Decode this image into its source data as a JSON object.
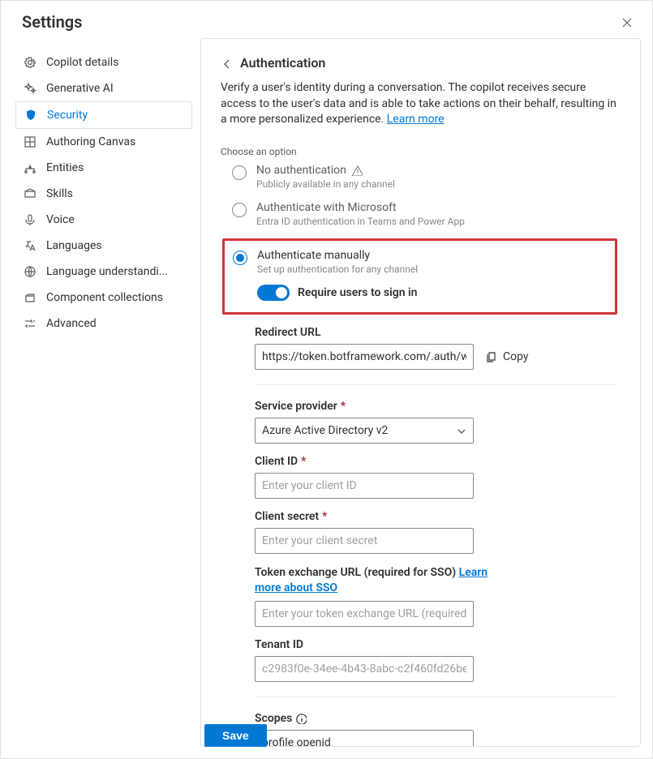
{
  "header": {
    "title": "Settings"
  },
  "sidebar": {
    "items": [
      {
        "label": "Copilot details"
      },
      {
        "label": "Generative AI"
      },
      {
        "label": "Security",
        "selected": true
      },
      {
        "label": "Authoring Canvas"
      },
      {
        "label": "Entities"
      },
      {
        "label": "Skills"
      },
      {
        "label": "Voice"
      },
      {
        "label": "Languages"
      },
      {
        "label": "Language understandi..."
      },
      {
        "label": "Component collections"
      },
      {
        "label": "Advanced"
      }
    ]
  },
  "page": {
    "title": "Authentication",
    "description_prefix": "Verify a user's identity during a conversation. The copilot receives secure access to the user's data and is able to take actions on their behalf, resulting in a more personalized experience. ",
    "learn_more": "Learn more",
    "choose_label": "Choose an option",
    "options": {
      "none": {
        "title": "No authentication",
        "sub": "Publicly available in any channel"
      },
      "ms": {
        "title": "Authenticate with Microsoft",
        "sub": "Entra ID authentication in Teams and Power App"
      },
      "manual": {
        "title": "Authenticate manually",
        "sub": "Set up authentication for any channel"
      }
    },
    "toggle_label": "Require users to sign in",
    "redirect": {
      "label": "Redirect URL",
      "value": "https://token.botframework.com/.auth/web/re",
      "copy": "Copy"
    },
    "service_provider": {
      "label": "Service provider",
      "value": "Azure Active Directory v2"
    },
    "client_id": {
      "label": "Client ID",
      "placeholder": "Enter your client ID"
    },
    "client_secret": {
      "label": "Client secret",
      "placeholder": "Enter your client secret"
    },
    "token_exchange": {
      "label_prefix": "Token exchange URL (required for SSO) ",
      "link": "Learn more about SSO",
      "placeholder": "Enter your token exchange URL (required for S"
    },
    "tenant_id": {
      "label": "Tenant ID",
      "value": "c2983f0e-34ee-4b43-8abc-c2f460fd26be"
    },
    "scopes": {
      "label": "Scopes",
      "value": "profile openid"
    }
  },
  "footer": {
    "save": "Save"
  }
}
